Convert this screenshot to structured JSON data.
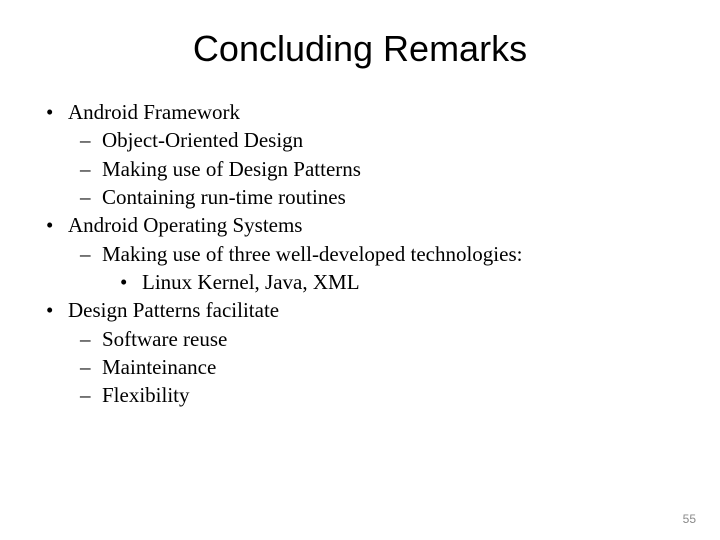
{
  "title": "Concluding Remarks",
  "page_number": "55",
  "bullets": [
    {
      "text": "Android Framework",
      "children": [
        {
          "text": "Object-Oriented Design"
        },
        {
          "text": "Making use of Design Patterns"
        },
        {
          "text": "Containing run-time routines"
        }
      ]
    },
    {
      "text": "Android Operating Systems",
      "children": [
        {
          "text": "Making use of three well-developed technologies:",
          "children": [
            {
              "text": "Linux Kernel, Java, XML"
            }
          ]
        }
      ]
    },
    {
      "text": "Design Patterns facilitate",
      "children": [
        {
          "text": "Software reuse"
        },
        {
          "text": "Mainteinance"
        },
        {
          "text": "Flexibility"
        }
      ]
    }
  ]
}
